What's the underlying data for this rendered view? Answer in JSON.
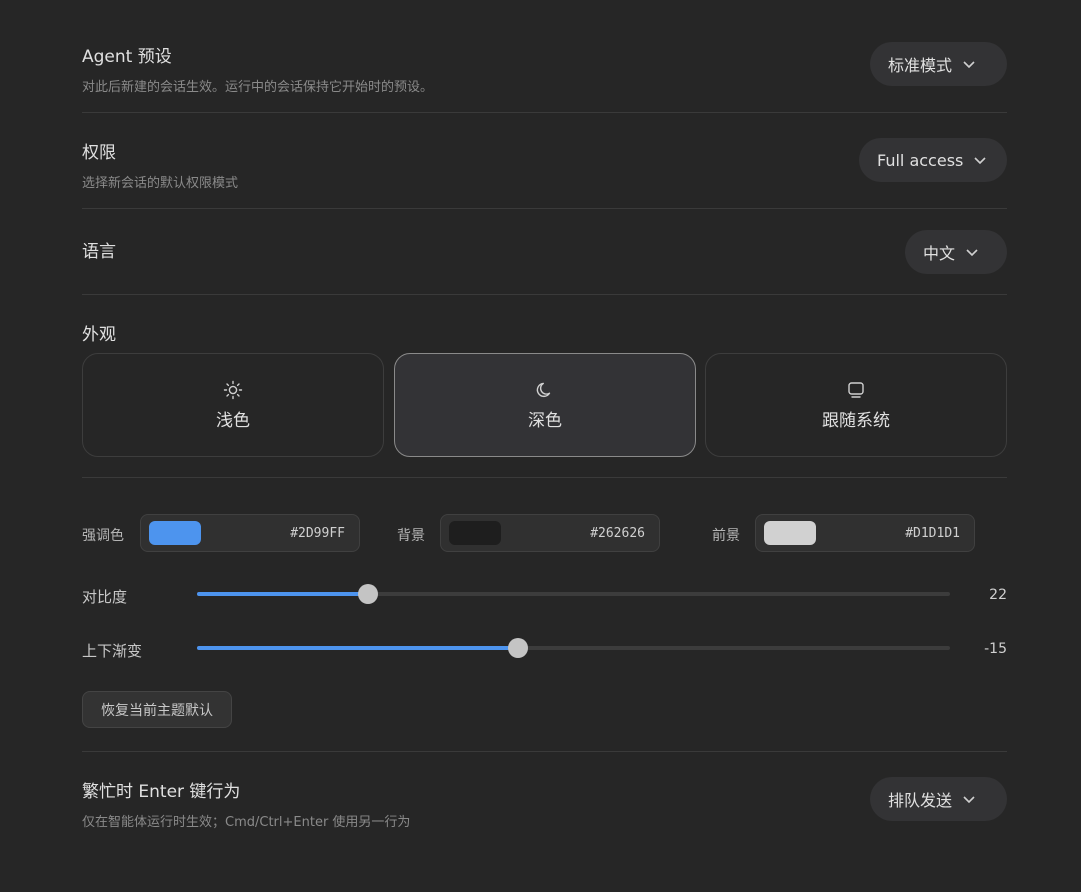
{
  "agent_preset": {
    "title": "Agent 预设",
    "description": "对此后新建的会话生效。运行中的会话保持它开始时的预设。",
    "value": "标准模式"
  },
  "permissions": {
    "title": "权限",
    "description": "选择新会话的默认权限模式",
    "value": "Full access"
  },
  "language": {
    "title": "语言",
    "value": "中文"
  },
  "appearance": {
    "title": "外观",
    "options": [
      {
        "label": "浅色",
        "icon": "sun-icon",
        "selected": false
      },
      {
        "label": "深色",
        "icon": "moon-icon",
        "selected": true
      },
      {
        "label": "跟随系统",
        "icon": "monitor-icon",
        "selected": false
      }
    ]
  },
  "colors": {
    "accent": {
      "label": "强调色",
      "hex": "#2D99FF",
      "swatch": "#4d94ee"
    },
    "background": {
      "label": "背景",
      "hex": "#262626",
      "swatch": "#1e1e1e"
    },
    "foreground": {
      "label": "前景",
      "hex": "#D1D1D1",
      "swatch": "#d1d1d1"
    }
  },
  "sliders": {
    "contrast": {
      "label": "对比度",
      "value": "22",
      "fraction": 0.227
    },
    "gradient": {
      "label": "上下渐变",
      "value": "-15",
      "fraction": 0.426
    }
  },
  "reset_label": "恢复当前主题默认",
  "busy_enter": {
    "title": "繁忙时 Enter 键行为",
    "description": "仅在智能体运行时生效；Cmd/Ctrl+Enter 使用另一行为",
    "value": "排队发送"
  }
}
